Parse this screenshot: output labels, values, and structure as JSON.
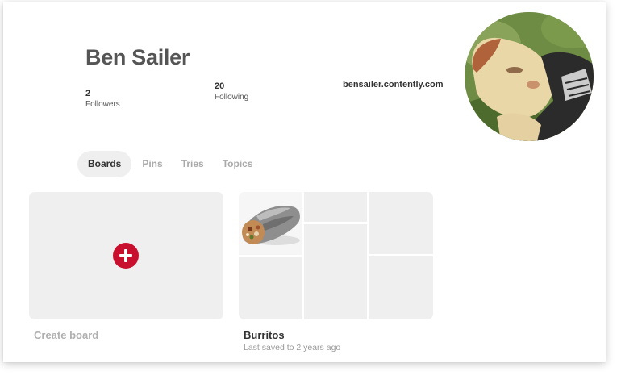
{
  "profile": {
    "name": "Ben Sailer",
    "followers_count": "2",
    "followers_label": "Followers",
    "following_count": "20",
    "following_label": "Following",
    "website": "bensailer.contently.com"
  },
  "tabs": [
    {
      "label": "Boards",
      "active": true
    },
    {
      "label": "Pins",
      "active": false
    },
    {
      "label": "Tries",
      "active": false
    },
    {
      "label": "Topics",
      "active": false
    }
  ],
  "boards": {
    "create": {
      "label": "Create board",
      "icon": "plus-icon"
    },
    "items": [
      {
        "title": "Burritos",
        "subtitle": "Last saved to 2 years ago"
      }
    ]
  },
  "colors": {
    "accent": "#c8102e",
    "placeholder": "#efefef",
    "muted_text": "#aaaaaa"
  }
}
